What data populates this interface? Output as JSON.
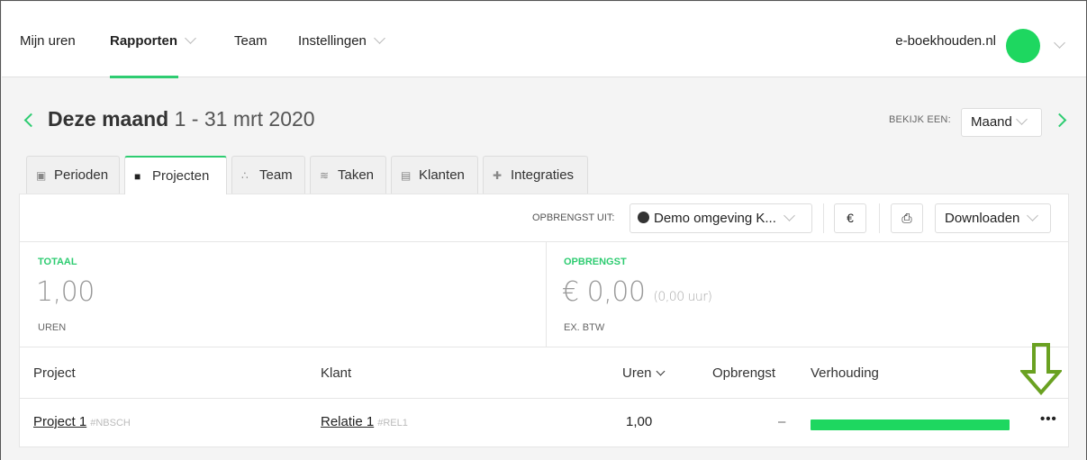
{
  "nav": {
    "items": [
      {
        "label": "Mijn uren"
      },
      {
        "label": "Rapporten"
      },
      {
        "label": "Team"
      },
      {
        "label": "Instellingen"
      }
    ],
    "company": "e-boekhouden.nl",
    "accent": "#2ecc71"
  },
  "period": {
    "title": "Deze maand",
    "range": "1 - 31 mrt 2020",
    "view_label": "BEKIJK EEN:",
    "view_value": "Maand"
  },
  "tabs": [
    {
      "label": "Perioden",
      "icon": "calendar-icon"
    },
    {
      "label": "Projecten",
      "icon": "folder-icon"
    },
    {
      "label": "Team",
      "icon": "users-icon"
    },
    {
      "label": "Taken",
      "icon": "layers-icon"
    },
    {
      "label": "Klanten",
      "icon": "briefcase-icon"
    },
    {
      "label": "Integraties",
      "icon": "puzzle-icon"
    }
  ],
  "toolbar": {
    "revenue_label": "OPBRENGST UIT:",
    "revenue_source": "Demo omgeving K...",
    "download_label": "Downloaden"
  },
  "stats": {
    "total": {
      "head": "TOTAAL",
      "value": "1,00",
      "sub": "UREN"
    },
    "revenue": {
      "head": "OPBRENGST",
      "value": "€ 0,00",
      "extra": "(0,00 uur)",
      "sub": "EX. BTW"
    }
  },
  "table": {
    "headers": {
      "project": "Project",
      "client": "Klant",
      "hours": "Uren",
      "revenue": "Opbrengst",
      "ratio": "Verhouding"
    },
    "rows": [
      {
        "project": "Project 1",
        "project_code": "#NBSCH",
        "client": "Relatie 1",
        "client_code": "#REL1",
        "hours": "1,00",
        "revenue": "–",
        "ratio": 1.0,
        "more": "•••"
      }
    ]
  }
}
